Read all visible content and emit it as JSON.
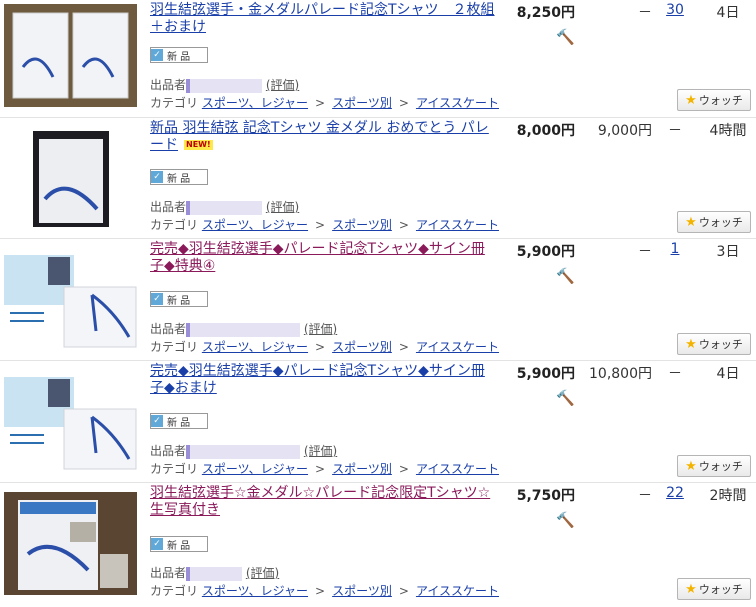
{
  "listings": [
    {
      "title": "羽生結弦選手・金メダルパレード記念Tシャツ　２枚組＋おまけ",
      "visited": false,
      "new_flag": "",
      "price": "8,250円",
      "buy_now": "－",
      "bids": "30",
      "bids_link": true,
      "time_left": "4日",
      "has_badge": true,
      "condition": "新 品",
      "seller_label": "出品者",
      "rating_link": "(評価)",
      "category_label": "カテゴリ",
      "categories": [
        "スポーツ、レジャー",
        "スポーツ別",
        "アイススケート"
      ],
      "watch_label": "ウォッチ",
      "thumb": "two-folded-white-tshirts"
    },
    {
      "title": "新品 羽生結弦 記念Tシャツ 金メダル おめでとう パレード",
      "visited": false,
      "new_flag": "NEW!",
      "price": "8,000円",
      "buy_now": "9,000円",
      "bids": "－",
      "bids_link": false,
      "time_left": "4時間",
      "has_badge": false,
      "condition": "新 品",
      "seller_label": "出品者",
      "rating_link": "(評価)",
      "category_label": "カテゴリ",
      "categories": [
        "スポーツ、レジャー",
        "スポーツ別",
        "アイススケート"
      ],
      "watch_label": "ウォッチ",
      "thumb": "packaged-tshirt"
    },
    {
      "title": "完売◆羽生結弦選手◆パレード記念Tシャツ◆サイン冊子◆特典④",
      "visited": true,
      "new_flag": "",
      "price": "5,900円",
      "buy_now": "－",
      "bids": "1",
      "bids_link": true,
      "time_left": "3日",
      "has_badge": true,
      "condition": "新 品",
      "seller_label": "出品者",
      "rating_link": "(評価)",
      "category_label": "カテゴリ",
      "categories": [
        "スポーツ、レジャー",
        "スポーツ別",
        "アイススケート"
      ],
      "watch_label": "ウォッチ",
      "thumb": "shirt-with-booklet"
    },
    {
      "title": "完売◆羽生結弦選手◆パレード記念Tシャツ◆サイン冊子◆おまけ",
      "visited": false,
      "new_flag": "",
      "price": "5,900円",
      "buy_now": "10,800円",
      "bids": "－",
      "bids_link": false,
      "time_left": "4日",
      "has_badge": true,
      "condition": "新 品",
      "seller_label": "出品者",
      "rating_link": "(評価)",
      "category_label": "カテゴリ",
      "categories": [
        "スポーツ、レジャー",
        "スポーツ別",
        "アイススケート"
      ],
      "watch_label": "ウォッチ",
      "thumb": "shirt-with-booklet"
    },
    {
      "title": "羽生結弦選手☆金メダル☆パレード記念限定Tシャツ☆生写真付き",
      "visited": true,
      "new_flag": "",
      "price": "5,750円",
      "buy_now": "－",
      "bids": "22",
      "bids_link": true,
      "time_left": "2時間",
      "has_badge": true,
      "condition": "新 品",
      "seller_label": "出品者",
      "rating_link": "(評価)",
      "category_label": "カテゴリ",
      "categories": [
        "スポーツ、レジャー",
        "スポーツ別",
        "アイススケート"
      ],
      "watch_label": "ウォッチ",
      "thumb": "shirt-with-photos"
    }
  ]
}
